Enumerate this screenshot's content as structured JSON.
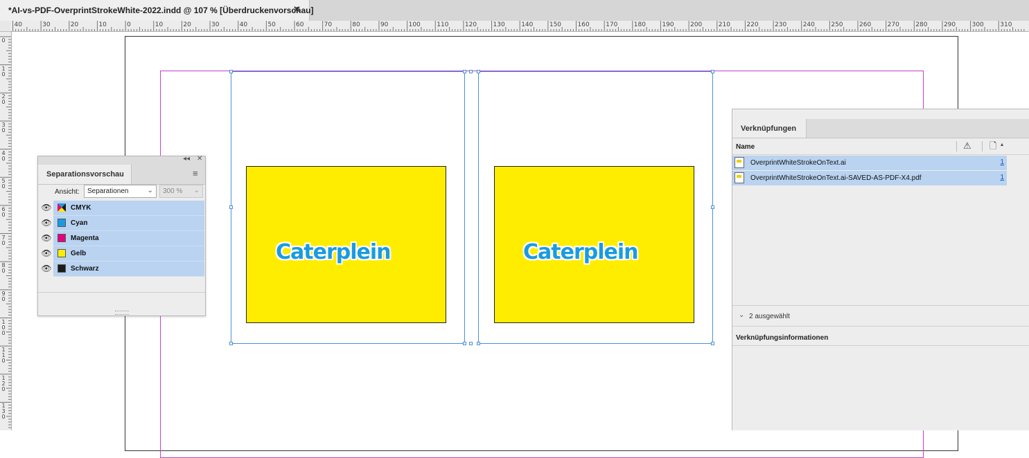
{
  "document_tab": {
    "title": "*AI-vs-PDF-OverprintStrokeWhite-2022.indd @ 107 % [Überdruckenvorschau]",
    "close_glyph": "✕"
  },
  "ruler": {
    "horizontal_labels": [
      "40",
      "30",
      "20",
      "10",
      "0",
      "10",
      "20",
      "30",
      "40",
      "50",
      "60",
      "70",
      "80",
      "90",
      "100",
      "110",
      "120",
      "130",
      "140",
      "150",
      "160",
      "170",
      "180",
      "190",
      "200",
      "210",
      "220",
      "230",
      "240",
      "250",
      "260",
      "270",
      "280",
      "290",
      "300",
      "310"
    ],
    "vertical_labels": [
      "0",
      "10",
      "20",
      "30",
      "40",
      "50",
      "60",
      "70",
      "80",
      "90",
      "100",
      "110",
      "120",
      "130"
    ]
  },
  "artwork": {
    "left_text": "Caterplein",
    "right_text": "Caterplein",
    "fill_color": "#ffed00",
    "text_color": "#1a9be0"
  },
  "separations_panel": {
    "tab_label": "Separationsvorschau",
    "view_label": "Ansicht:",
    "view_value": "Separationen",
    "zoom_value": "300 %",
    "rows": [
      {
        "label": "CMYK",
        "swatch": "cmyk"
      },
      {
        "label": "Cyan",
        "swatch": "#1a9be0"
      },
      {
        "label": "Magenta",
        "swatch": "#e6007e"
      },
      {
        "label": "Gelb",
        "swatch": "#ffed00"
      },
      {
        "label": "Schwarz",
        "swatch": "#1a1a1a"
      }
    ]
  },
  "links_panel": {
    "tab_label": "Verknüpfungen",
    "name_header": "Name",
    "files": [
      {
        "name": "OverprintWhiteStrokeOnText.ai",
        "page": "1"
      },
      {
        "name": "OverprintWhiteStrokeOnText.ai-SAVED-AS-PDF-X4.pdf",
        "page": "1"
      }
    ],
    "selected_count": "2 ausgewählt",
    "info_header": "Verknüpfungsinformationen"
  }
}
